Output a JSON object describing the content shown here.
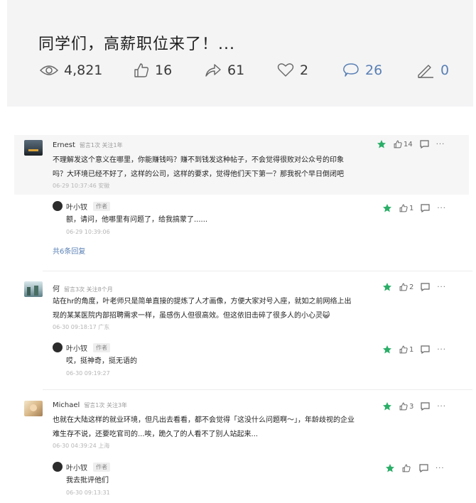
{
  "article": {
    "title": "同学们，高薪职位来了！...",
    "stats": {
      "views": "4,821",
      "likes": "16",
      "shares": "61",
      "favorites": "2",
      "comments": "26",
      "edits": "0"
    }
  },
  "colors": {
    "accent": "#5a80b4",
    "star": "#2aae67",
    "header_bg": "#f4f4f5"
  },
  "comments": [
    {
      "name": "Ernest",
      "meta": "留言1次 关注1年",
      "lines": [
        "不理解发这个意义在哪里，你能赚钱吗？赚不到钱发这种帖子，不会觉得很败对公众号的印象",
        "吗？大环境已经不好了，这样的公司，这样的要求，觉得他们天下第一？那我祝个早日倒闭吧"
      ],
      "time": "06-29 10:37:46 安徽",
      "likes": "14",
      "reply": {
        "name": "叶小钗",
        "tag": "作者",
        "text": "额，请问，他哪里有问题了，给我搞蒙了......",
        "time": "06-29 10:39:06",
        "likes": "1"
      },
      "more": "共6条回复"
    },
    {
      "name": "何",
      "meta": "留言3次 关注8个月",
      "lines": [
        "站在hr的角度，叶老师只是简单直接的提炼了人才画像，方便大家对号入座，就如之前网络上出",
        "现的某某医院内部招聘需求一样，虽感伤人但很高效。但这依旧击碎了很多人的小心灵😺"
      ],
      "time": "06-30 09:18:17 广东",
      "likes": "2",
      "reply": {
        "name": "叶小钗",
        "tag": "作者",
        "text": "哎，挺神奇，挺无语的",
        "time": "06-30 09:19:27",
        "likes": "1"
      }
    },
    {
      "name": "Michael",
      "meta": "留言1次 关注3年",
      "lines": [
        "也就在大陆这样的就业环境，但凡出去看看，都不会觉得「这没什么问题啊～」，年龄歧视的企业",
        "难生存不说，还要吃官司的...唉，跪久了的人看不了别人站起来..."
      ],
      "time": "06-30 04:39:24 上海",
      "likes": "3",
      "reply": {
        "name": "叶小钗",
        "tag": "作者",
        "text": "我去批评他们",
        "time": "06-30 09:13:31",
        "likes": ""
      }
    }
  ]
}
